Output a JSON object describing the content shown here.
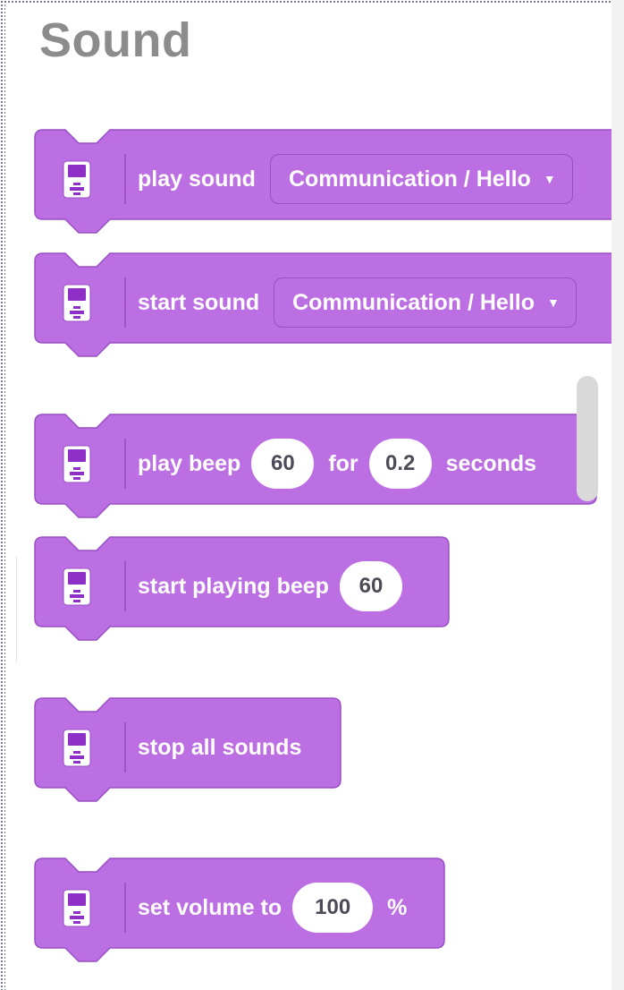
{
  "category": {
    "title": "Sound"
  },
  "blocks": [
    {
      "label": "play sound",
      "dropdown_value": "Communication / Hello"
    },
    {
      "label": "start sound",
      "dropdown_value": "Communication / Hello"
    },
    {
      "label": "play beep",
      "note_value": "60",
      "for_label": "for",
      "duration_value": "0.2",
      "seconds_label": "seconds"
    },
    {
      "label": "start playing beep",
      "note_value": "60"
    },
    {
      "label": "stop all sounds"
    },
    {
      "label": "set volume to",
      "volume_value": "100",
      "percent_label": "%"
    }
  ],
  "colors": {
    "block_fill": "#bc6ee3",
    "block_border": "#9a4fc4",
    "title": "#8c8c8c",
    "input_fill": "#ffffff"
  },
  "icons": [
    "brick-device-icon",
    "dropdown-caret-icon"
  ]
}
